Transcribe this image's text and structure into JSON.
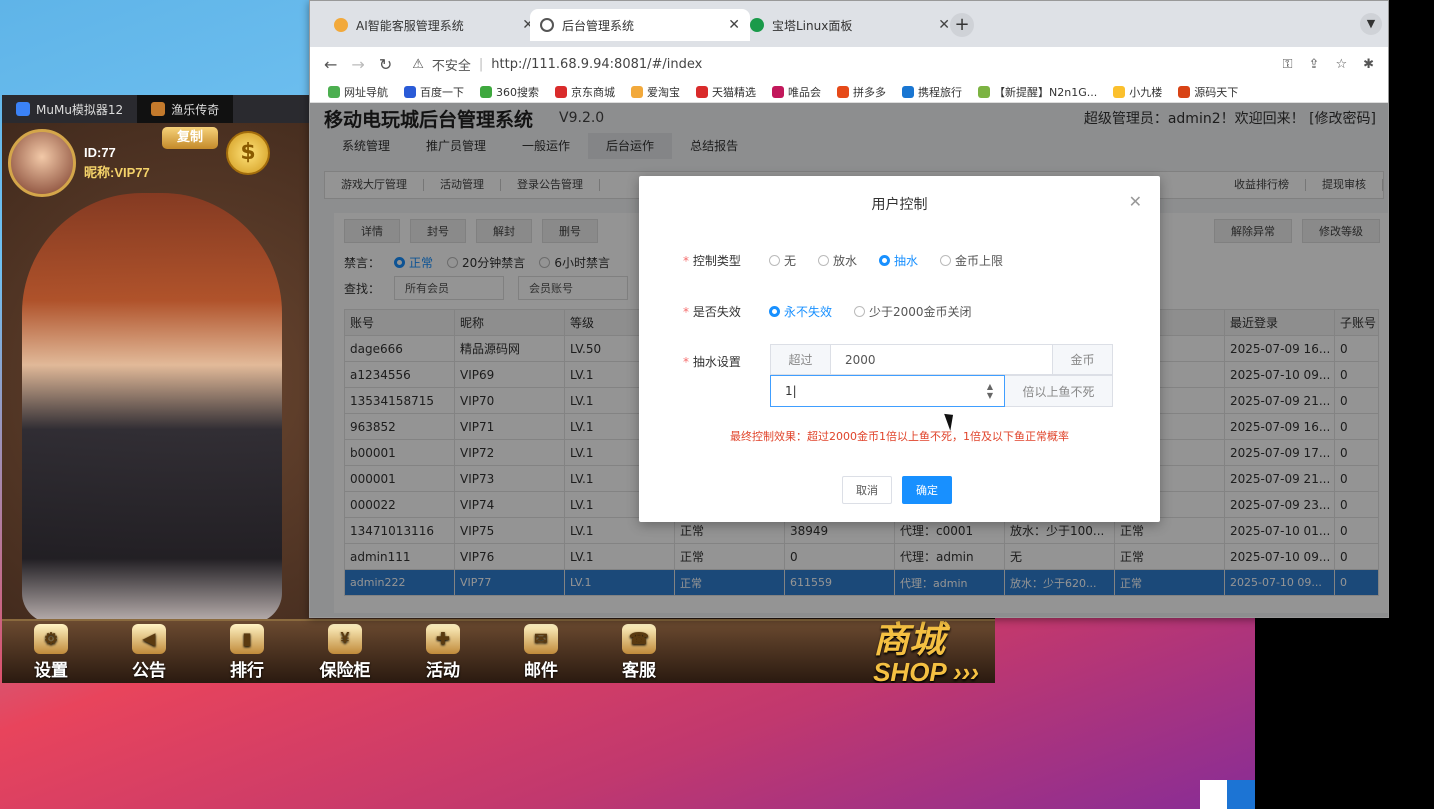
{
  "emulator": {
    "tabs": [
      {
        "label": "MuMu模拟器12"
      },
      {
        "label": "渔乐传奇"
      }
    ],
    "game": {
      "id_label": "ID:77",
      "nickname": "昵称:VIP77",
      "copy_btn": "复制",
      "coin_symbol": "$",
      "bottom_buttons": [
        {
          "label": "设置",
          "icon": "gear-icon"
        },
        {
          "label": "公告",
          "icon": "speaker-icon"
        },
        {
          "label": "排行",
          "icon": "bar-chart-icon"
        },
        {
          "label": "保险柜",
          "icon": "safe-icon"
        },
        {
          "label": "活动",
          "icon": "gift-icon"
        },
        {
          "label": "邮件",
          "icon": "mail-icon"
        },
        {
          "label": "客服",
          "icon": "headset-icon"
        }
      ],
      "shop_cn": "商城",
      "shop_en": "SHOP"
    }
  },
  "browser": {
    "tabs": [
      {
        "label": "AI智能客服管理系统"
      },
      {
        "label": "后台管理系统"
      },
      {
        "label": "宝塔Linux面板"
      }
    ],
    "insecure": "不安全",
    "url": "http://111.68.9.94:8081/#/index",
    "bookmarks": [
      "网址导航",
      "百度一下",
      "360搜索",
      "京东商城",
      "爱淘宝",
      "天猫精选",
      "唯品会",
      "拼多多",
      "携程旅行",
      "【新提醒】N2n1G...",
      "小九楼",
      "源码天下"
    ]
  },
  "app": {
    "title": "移动电玩城后台管理系统",
    "version": "V9.2.0",
    "user_text": "超级管理员：admin2！欢迎回来！ [修改密码]",
    "main_nav": [
      "系统管理",
      "推广员管理",
      "一般运作",
      "后台运作",
      "总结报告"
    ],
    "sub_nav": [
      "游戏大厅管理",
      "活动管理",
      "登录公告管理"
    ],
    "sub_nav_right": [
      "收益排行榜",
      "提现审核"
    ],
    "toolbar": [
      "详情",
      "封号",
      "解封",
      "删号"
    ],
    "toolbar_right": [
      "解除异常",
      "修改等级"
    ],
    "mute_label": "禁言：",
    "mute_opts": [
      "正常",
      "20分钟禁言",
      "6小时禁言"
    ],
    "search_label": "查找：",
    "search_sel1": "所有会员",
    "search_sel2": "会员账号",
    "columns": [
      "账号",
      "昵称",
      "等级",
      "",
      "",
      "",
      "",
      "",
      "最近登录",
      "子账号"
    ],
    "rows": [
      [
        "dage666",
        "精品源码网",
        "LV.50",
        "",
        "",
        "",
        "",
        "",
        "2025-07-09 16...",
        "0"
      ],
      [
        "a1234556",
        "VIP69",
        "LV.1",
        "",
        "",
        "",
        "",
        "",
        "2025-07-10 09...",
        "0"
      ],
      [
        "13534158715",
        "VIP70",
        "LV.1",
        "",
        "",
        "",
        "",
        "",
        "2025-07-09 21...",
        "0"
      ],
      [
        "963852",
        "VIP71",
        "LV.1",
        "",
        "",
        "",
        "",
        "",
        "2025-07-09 16...",
        "0"
      ],
      [
        "b00001",
        "VIP72",
        "LV.1",
        "",
        "",
        "",
        "",
        "",
        "2025-07-09 17...",
        "0"
      ],
      [
        "000001",
        "VIP73",
        "LV.1",
        "",
        "",
        "",
        "",
        "",
        "2025-07-09 21...",
        "0"
      ],
      [
        "000022",
        "VIP74",
        "LV.1",
        "",
        "",
        "",
        "",
        "",
        "2025-07-09 23...",
        "0"
      ],
      [
        "13471013116",
        "VIP75",
        "LV.1",
        "正常",
        "38949",
        "代理：c0001",
        "放水：少于100...",
        "正常",
        "2025-07-10 01...",
        "0"
      ],
      [
        "admin111",
        "VIP76",
        "LV.1",
        "正常",
        "0",
        "代理：admin",
        "无",
        "正常",
        "2025-07-10 09...",
        "0"
      ],
      [
        "admin222",
        "VIP77",
        "LV.1",
        "正常",
        "611559",
        "代理：admin",
        "放水：少于620...",
        "正常",
        "2025-07-10 09...",
        "0"
      ]
    ],
    "selected_row": 9
  },
  "modal": {
    "title": "用户控制",
    "type_label": "控制类型",
    "type_opts": [
      "无",
      "放水",
      "抽水",
      "金币上限"
    ],
    "type_selected": 2,
    "expire_label": "是否失效",
    "expire_opts": [
      "永不失效",
      "少于2000金币关闭"
    ],
    "expire_selected": 0,
    "draw_label": "抽水设置",
    "exceed_prefix": "超过",
    "exceed_value": "2000",
    "exceed_suffix": "金币",
    "multiplier_value": "1",
    "multiplier_suffix": "倍以上鱼不死",
    "effect": "最终控制效果：超过2000金币1倍以上鱼不死，1倍及以下鱼正常概率",
    "cancel": "取消",
    "ok": "确定"
  },
  "colors": {
    "accent": "#1890ff",
    "warning": "#e0442b",
    "selected_row": "#2f7fd0"
  }
}
